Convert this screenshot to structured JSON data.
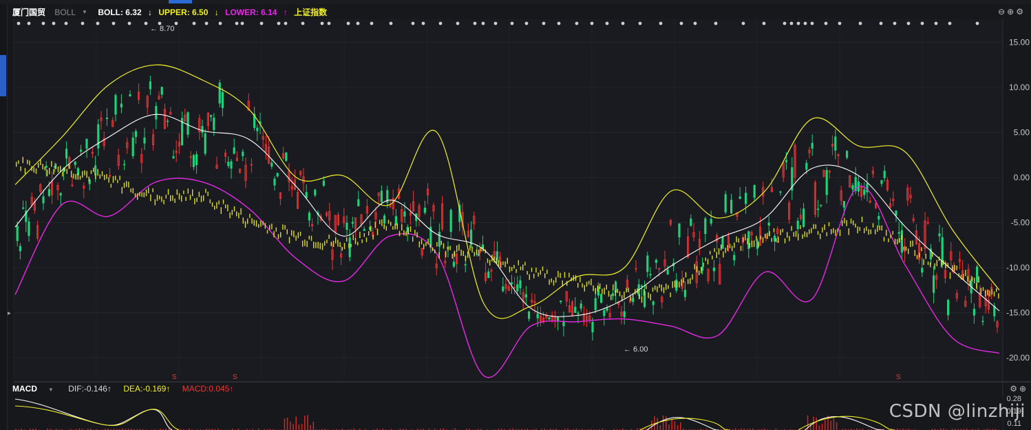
{
  "header": {
    "stock_name": "厦门国贸",
    "indicator": "BOLL",
    "boll_label": "BOLL: 6.32",
    "boll_arrow": "↓",
    "upper_label": "UPPER: 6.50",
    "upper_arrow": "↓",
    "lower_label": "LOWER: 6.14",
    "lower_arrow": "↑",
    "compare_index": "上证指数"
  },
  "controls": {
    "zoom_out": "⊖",
    "zoom_in": "⊕",
    "settings": "⚙"
  },
  "annotations": {
    "high_label": "8.70",
    "low_label": "6.00",
    "signal_mark": "S"
  },
  "y_axis_labels": [
    "15.00",
    "10.00",
    "5.00",
    "0.00",
    "-5.00",
    "-10.00",
    "-15.00",
    "-20.00"
  ],
  "macd": {
    "name": "MACD",
    "dif_label": "DIF:-0.146↑",
    "dea_label": "DEA:-0.169↑",
    "macd_label": "MACD:0.045↑",
    "axis_labels": [
      "0.28",
      "0.19",
      "0.11"
    ]
  },
  "watermark": "CSDN @linzhiji",
  "colors": {
    "background": "#17181c",
    "candle_up": "#f03535",
    "candle_down": "#1fd17a",
    "boll_mid": "#ffffff",
    "boll_upper": "#f2f22a",
    "boll_lower": "#e629e6",
    "index_line": "#f2f22a"
  },
  "chart_data": {
    "type": "line",
    "title": "",
    "y_scale_labels": [
      15,
      10,
      5,
      0,
      -5,
      -10,
      -15,
      -20
    ],
    "series": [
      {
        "name": "BOLL",
        "values": [
          -5.5,
          0.8,
          4.5,
          7.0,
          5.2,
          4.2,
          -1.0,
          -6.5,
          -2.5,
          -6.3,
          -8.0,
          -14.5,
          -15.3,
          -13.5,
          -9.8,
          -6.8,
          -4.5,
          1.0,
          0.2,
          -5.5,
          -10.3,
          -14.8
        ]
      },
      {
        "name": "UPPER",
        "values": [
          -0.8,
          4.5,
          10.3,
          12.5,
          10.8,
          7.5,
          0.0,
          0.2,
          -3.0,
          5.0,
          -14.0,
          -14.3,
          -11.0,
          -10.0,
          -1.5,
          -4.5,
          -1.5,
          6.5,
          3.5,
          2.8,
          -5.8,
          -12.5
        ]
      },
      {
        "name": "LOWER",
        "values": [
          -13.0,
          -3.0,
          -4.3,
          -0.5,
          -0.5,
          -3.5,
          -9.0,
          -11.5,
          -6.5,
          -8.5,
          -22.0,
          -16.5,
          -16.0,
          -15.7,
          -16.5,
          -17.5,
          -10.5,
          -13.5,
          -1.0,
          -9.8,
          -17.8,
          -19.5
        ]
      },
      {
        "name": "上证指数",
        "values": [
          1.5,
          1.0,
          -0.2,
          -2.2,
          -2.0,
          -4.8,
          -6.5,
          -7.5,
          -5.0,
          -7.8,
          -8.5,
          -10.5,
          -11.5,
          -13.0,
          -12.5,
          -8.0,
          -6.5,
          -6.0,
          -5.0,
          -7.5,
          -10.5,
          -12.8
        ]
      }
    ]
  }
}
